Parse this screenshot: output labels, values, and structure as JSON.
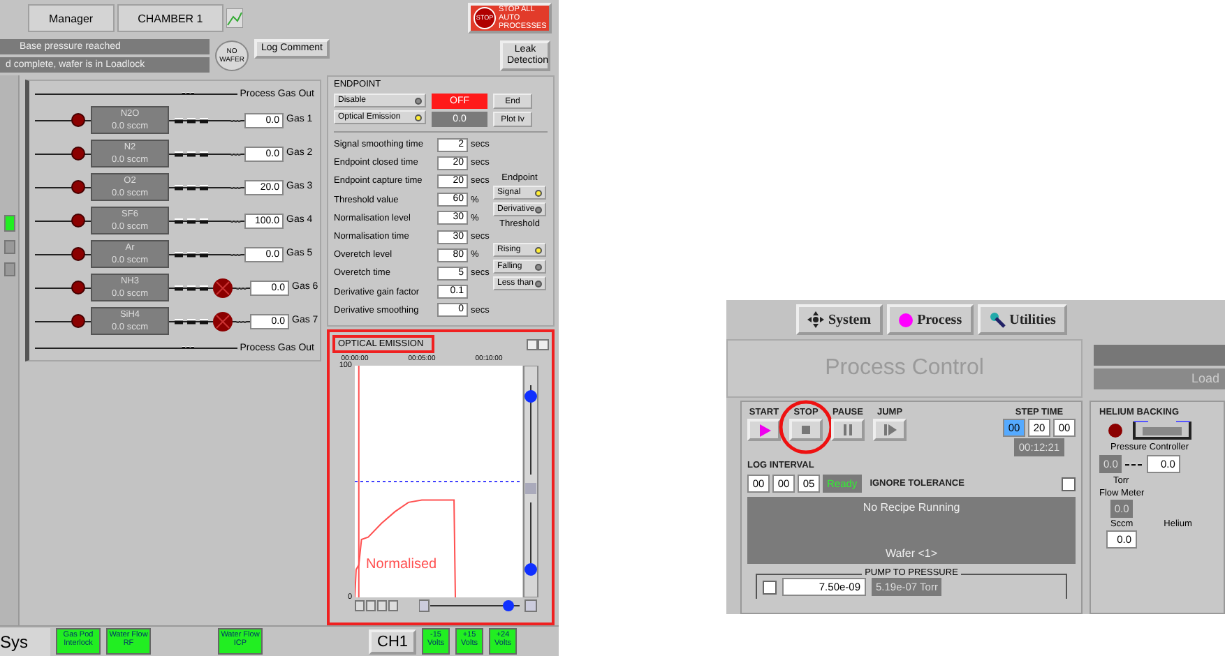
{
  "left_screen": {
    "top_bar": {
      "tabs": [
        "Manager",
        "CHAMBER 1"
      ],
      "stop_button": {
        "sign": "STOP",
        "label": "STOP ALL AUTO PROCESSES"
      }
    },
    "messages": [
      "Base pressure reached",
      "d complete, wafer is in Loadlock"
    ],
    "wafer_badge": "NO WAFER",
    "log_button": "Log Comment",
    "leak_button": "Leak Detection",
    "gas_panel": {
      "outlet_top": "Process Gas Out",
      "outlet_bottom": "Process Gas Out",
      "gases": [
        {
          "name": "N2O",
          "flow": "0.0 sccm",
          "setpoint": "0.0",
          "label": "Gas 1",
          "kind": "standard"
        },
        {
          "name": "N2",
          "flow": "0.0 sccm",
          "setpoint": "0.0",
          "label": "Gas 2",
          "kind": "standard"
        },
        {
          "name": "O2",
          "flow": "0.0 sccm",
          "setpoint": "20.0",
          "label": "Gas 3",
          "kind": "standard"
        },
        {
          "name": "SF6",
          "flow": "0.0 sccm",
          "setpoint": "100.0",
          "label": "Gas 4",
          "kind": "standard"
        },
        {
          "name": "Ar",
          "flow": "0.0 sccm",
          "setpoint": "0.0",
          "label": "Gas 5",
          "kind": "standard"
        },
        {
          "name": "NH3",
          "flow": "0.0 sccm",
          "setpoint": "0.0",
          "label": "Gas 6",
          "kind": "bypass"
        },
        {
          "name": "SiH4",
          "flow": "0.0 sccm",
          "setpoint": "0.0",
          "label": "Gas 7",
          "kind": "bypass"
        }
      ]
    },
    "endpoint": {
      "title": "ENDPOINT",
      "modes": [
        {
          "label": "Disable",
          "selected": false
        },
        {
          "label": "Optical Emission",
          "selected": true
        }
      ],
      "state": "OFF",
      "value": "0.0",
      "end_button": "End",
      "plot_button": "Plot Iv",
      "parameters": [
        {
          "label": "Signal smoothing time",
          "value": "2",
          "unit": "secs"
        },
        {
          "label": "Endpoint closed time",
          "value": "20",
          "unit": "secs"
        },
        {
          "label": "Endpoint capture time",
          "value": "20",
          "unit": "secs"
        },
        {
          "label": "Threshold value",
          "value": "60",
          "unit": "%"
        },
        {
          "label": "Normalisation level",
          "value": "30",
          "unit": "%"
        },
        {
          "label": "Normalisation time",
          "value": "30",
          "unit": "secs"
        },
        {
          "label": "Overetch level",
          "value": "80",
          "unit": "%"
        },
        {
          "label": "Overetch time",
          "value": "5",
          "unit": "secs"
        },
        {
          "label": "Derivative gain factor",
          "value": "0.1"
        },
        {
          "label": "Derivative smoothing",
          "value": "0",
          "unit": "secs"
        }
      ],
      "endpoint_label": "Endpoint",
      "endpoint_options": [
        {
          "label": "Signal",
          "selected": true
        },
        {
          "label": "Derivative",
          "selected": false
        }
      ],
      "threshold_label": "Threshold",
      "threshold_options": [
        {
          "label": "Rising",
          "selected": true
        },
        {
          "label": "Falling",
          "selected": false
        },
        {
          "label": "Less than",
          "selected": false
        }
      ]
    },
    "optical_emission": {
      "title": "OPTICAL EMISSION",
      "chart_data": {
        "type": "line",
        "x": [
          0,
          0.1,
          0.3,
          0.5,
          1,
          2,
          3,
          4,
          5,
          6,
          7.4,
          7.5
        ],
        "series": [
          {
            "name": "Normalised",
            "color": "#ff5050",
            "values": [
              0,
              12,
              14,
              25,
              26,
              32,
              37,
              41,
              42,
              42,
              42,
              0
            ]
          }
        ],
        "xlim": [
          0,
          12.5
        ],
        "ylim": [
          0,
          100
        ],
        "xticks": [
          {
            "value": 0,
            "label": "00:00:00"
          },
          {
            "value": 5,
            "label": "00:05:00"
          },
          {
            "value": 10,
            "label": "00:10:00"
          }
        ],
        "yticks": [
          0,
          100
        ],
        "ref_lines": [
          {
            "axis": "y",
            "value": 50,
            "color": "#4040ff"
          },
          {
            "axis": "x",
            "value": 0.3,
            "color": "#ff5050"
          }
        ]
      }
    },
    "status_bar": {
      "tab": "Sys",
      "indicators": [
        {
          "label": "Gas Pod Interlock",
          "ok": true
        },
        {
          "label": "Water Flow RF",
          "ok": true
        },
        {
          "label": "Water Flow ICP",
          "ok": true
        }
      ],
      "channel": "CH1",
      "voltages": [
        {
          "label": "-15 Volts",
          "ok": true
        },
        {
          "label": "+15 Volts",
          "ok": true
        },
        {
          "label": "+24 Volts",
          "ok": true
        }
      ]
    }
  },
  "right_screen": {
    "tabs": [
      "System",
      "Process",
      "Utilities"
    ],
    "title": "Process Control",
    "status_text": "Load",
    "transport": [
      {
        "label": "START",
        "kind": "play"
      },
      {
        "label": "STOP",
        "kind": "stop"
      },
      {
        "label": "PAUSE",
        "kind": "pause"
      },
      {
        "label": "JUMP",
        "kind": "jump"
      }
    ],
    "step_time": {
      "label": "STEP TIME",
      "fields": [
        {
          "value": "00",
          "selected": true
        },
        {
          "value": "20",
          "selected": false
        },
        {
          "value": "00",
          "selected": false
        }
      ],
      "elapsed": "00:12:21"
    },
    "log_interval": {
      "label": "LOG INTERVAL",
      "fields": [
        "00",
        "00",
        "05"
      ],
      "status": "Ready"
    },
    "ignore_tolerance": {
      "label": "IGNORE TOLERANCE",
      "checked": false
    },
    "recipe": {
      "status": "No Recipe Running",
      "wafer": "Wafer <1>"
    },
    "pump_to_pressure": {
      "label": "PUMP TO PRESSURE",
      "checked": false,
      "setpoint": "7.50e-09",
      "reading": "5.19e-07 Torr"
    },
    "helium_backing": {
      "title": "HELIUM BACKING",
      "controller_label": "Pressure Controller",
      "pressure": "0.0",
      "pressure_unit": "Torr",
      "setpoint": "0.0",
      "flow_label": "Flow Meter",
      "flow": "0.0",
      "flow_unit": "Sccm",
      "flow_setpoint": "0.0",
      "source": "Helium"
    }
  }
}
